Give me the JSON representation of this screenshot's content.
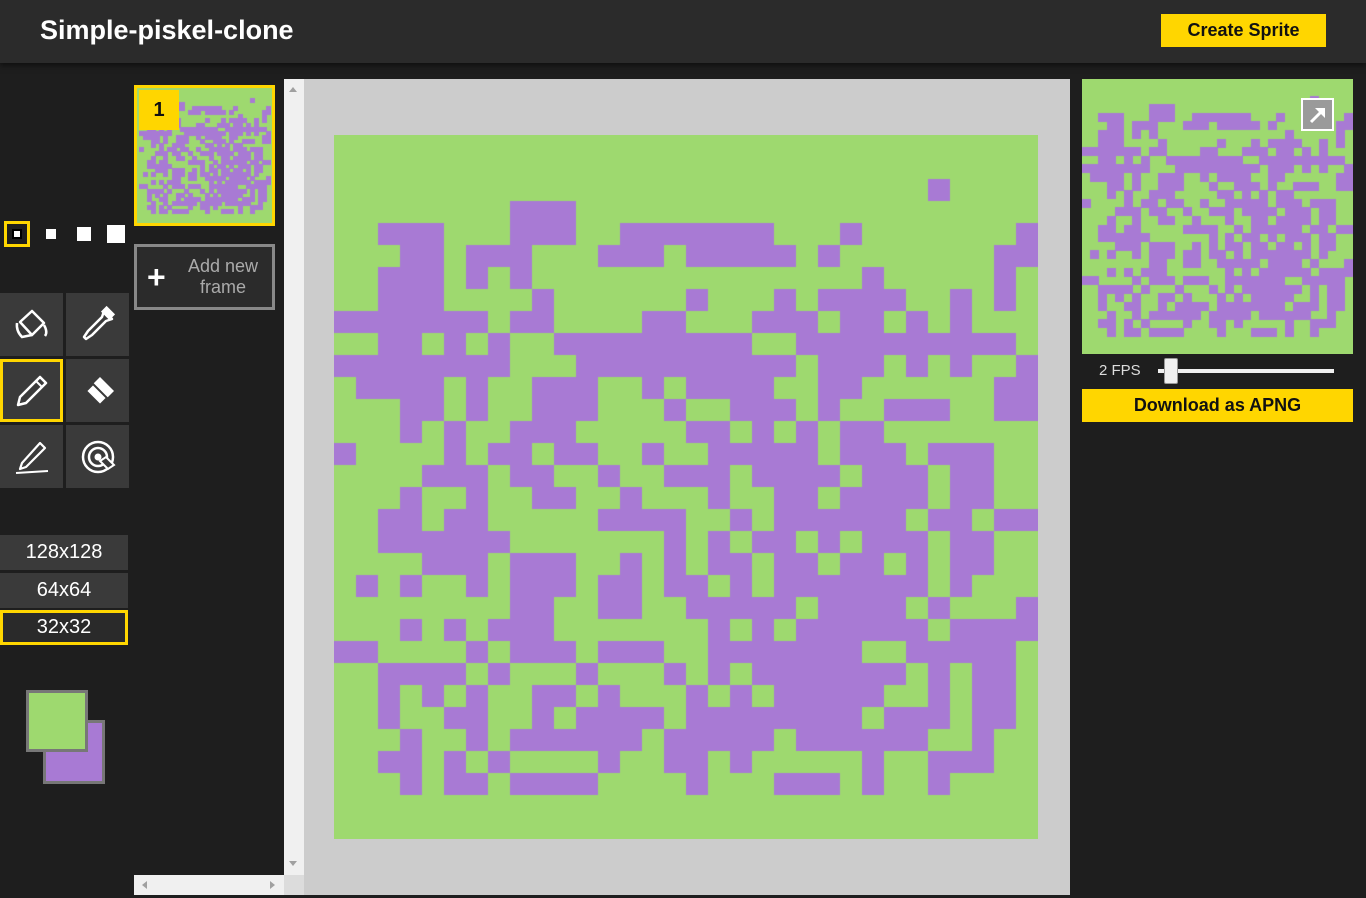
{
  "header": {
    "title": "Simple-piskel-clone",
    "create_label": "Create Sprite"
  },
  "tools": {
    "pen_sizes": [
      1,
      2,
      3,
      4
    ],
    "selected_pen_size": 1,
    "items": [
      {
        "name": "paint-bucket",
        "icon": "paint-bucket-icon"
      },
      {
        "name": "color-picker",
        "icon": "eyedropper-icon"
      },
      {
        "name": "pen",
        "icon": "pencil-icon",
        "selected": true
      },
      {
        "name": "eraser",
        "icon": "eraser-icon"
      },
      {
        "name": "stroke",
        "icon": "stroke-pen-icon"
      },
      {
        "name": "same-color-fill",
        "icon": "pixel-target-icon"
      }
    ]
  },
  "resolutions": [
    {
      "label": "128x128"
    },
    {
      "label": "64x64"
    },
    {
      "label": "32x32",
      "selected": true
    }
  ],
  "colors": {
    "primary": "#9ed96f",
    "secondary": "#a87ad4",
    "accent": "#ffd600"
  },
  "frames": {
    "items": [
      {
        "index": "1"
      }
    ],
    "add_label": "Add new frame"
  },
  "preview": {
    "fps_label": "2 FPS",
    "fps_value": 2,
    "download_label": "Download as APNG"
  },
  "sprite": {
    "size": 32,
    "pixels": [
      "................................",
      "................................",
      "...........................+....",
      "........+++.....................",
      "..+++...+++..+++++++...+.......+",
      "...++.+++...+++.+++++.+.......++",
      "..+++.+.+...............+.....+.",
      "..+++....+......+...+.++++..+.+.",
      "+++++++.++....++...+++.++.+.+...",
      "..++.+.+..+++++++++..++++++++++.",
      "++++++++...++++++++++.+++.+.+..+",
      ".++++.+..+++..+.++++..++......++",
      "...++.+..+++...+..+++.+..+++..++",
      "...+.+..+++.....++.+.+.++.......",
      "+....+.++.++..+..+++++.+++.+++..",
      "....+++.++..+..+++.++++.+++.++..",
      "...+..+..++..+...+..++.++++.++..",
      "..++.++.....++++..+.++++++.++.++",
      "..++++++.......+.+.++.+.+++.++..",
      "....+++.+++..+.+.++.++.++.+.++..",
      ".+.+..+.+++.++.++.+.+++++++.+...",
      "........++..++..+++++.++++.+...+",
      "...+.+.+++.......+.+.++++++.++++",
      "++....+.+++.+++..+++++++..+++++.",
      "..++++.+...+...+.+.+++++++.+.++.",
      "..+.+.+..++.+...+.+.+++++..+.++.",
      "..+..++..+.++++.++++++++.+++.++.",
      "...+..+.++++++.+++++.++++++..+..",
      "..++.+.+....+..++.+.....+..+++..",
      "...+.++.++++....+...+++.+..+....",
      "................................",
      "................................"
    ]
  }
}
